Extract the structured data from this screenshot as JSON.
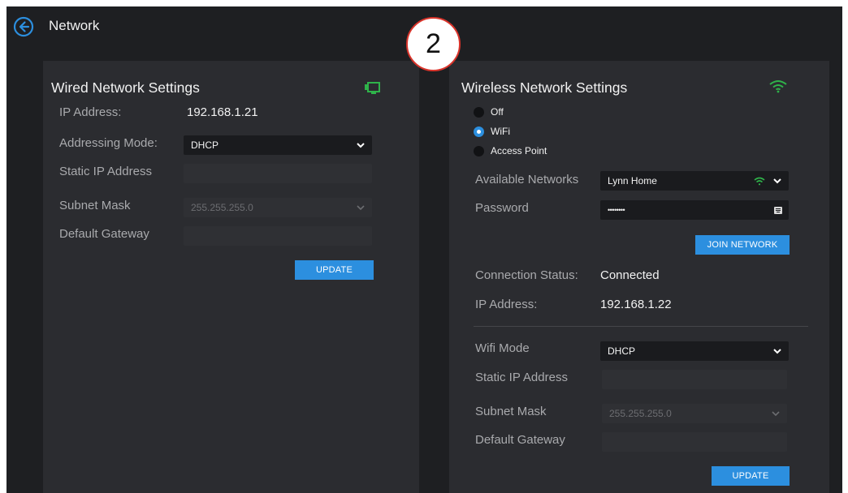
{
  "header": {
    "title": "Network",
    "step_number": "2"
  },
  "wired": {
    "title": "Wired Network Settings",
    "ip_label": "IP Address:",
    "ip_value": "192.168.1.21",
    "mode_label": "Addressing Mode:",
    "mode_value": "DHCP",
    "static_ip_label": "Static IP Address",
    "static_ip_value": "",
    "subnet_label": "Subnet Mask",
    "subnet_value": "255.255.255.0",
    "gateway_label": "Default Gateway",
    "gateway_value": "",
    "update_label": "UPDATE"
  },
  "wireless": {
    "title": "Wireless Network Settings",
    "radio_options": [
      "Off",
      "WiFi",
      "Access Point"
    ],
    "radio_selected": "WiFi",
    "networks_label": "Available Networks",
    "network_value": "Lynn Home",
    "password_label": "Password",
    "password_value": "••••••••",
    "join_label": "JOIN NETWORK",
    "status_label": "Connection Status:",
    "status_value": "Connected",
    "ip_label": "IP Address:",
    "ip_value": "192.168.1.22",
    "wifi_mode_label": "Wifi Mode",
    "wifi_mode_value": "DHCP",
    "static_ip_label": "Static IP Address",
    "static_ip_value": "",
    "subnet_label": "Subnet Mask",
    "subnet_value": "255.255.255.0",
    "gateway_label": "Default Gateway",
    "gateway_value": "",
    "update_label": "UPDATE"
  },
  "colors": {
    "accent_blue": "#2c8fdf",
    "status_green": "#2fb34a",
    "badge_border": "#d9342b"
  },
  "icons": {
    "back": "back-arrow-circle-icon",
    "wired_status": "ethernet-monitor-icon",
    "wireless_status": "wifi-icon",
    "network_signal": "wifi-signal-icon",
    "password_keyboard": "keyboard-icon",
    "dropdown": "chevron-down-icon"
  }
}
